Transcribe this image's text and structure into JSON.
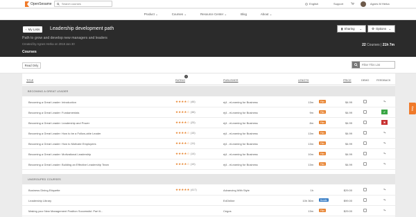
{
  "brand": {
    "name": "OpenSesame"
  },
  "top": {
    "search_placeholder": "Search courses",
    "language": "English",
    "support": "Support",
    "user": "Agnes M Herka"
  },
  "nav": [
    {
      "label": "Product ⌄"
    },
    {
      "label": "Courses ⌄"
    },
    {
      "label": "Resource Center ⌄"
    },
    {
      "label": "Blog"
    },
    {
      "label": "About ⌄"
    }
  ],
  "hero": {
    "back_label": "My Lists",
    "title": "Leadership development path",
    "subtitle": "Path to grow and develop new managers and leaders",
    "created": "Created by Agnes Herka on 2018 Jan 30",
    "sharing": "Sharing",
    "options": "Options",
    "count": "22",
    "count_label": "Courses",
    "duration": "21h 7m",
    "section": "Courses"
  },
  "toolbar": {
    "readonly": "Read Only",
    "filter_placeholder": "Filter This List"
  },
  "columns": {
    "title": "TITLE",
    "rating": "RATING",
    "publisher": "PUBLISHER",
    "length": "LENGTH",
    "price": "PRICE",
    "demo": "DEMO",
    "feedback": "FEEDBACK",
    "help": "?"
  },
  "groups": [
    {
      "label": "BECOMING A GREAT LEADER"
    },
    {
      "label": "UNGROUPED COURSES"
    }
  ],
  "rows": [
    {
      "title": "Becoming a Great Leader: Introduction",
      "stars": "★★★★☆",
      "count": "(46)",
      "publisher": "ej4 - eLearning for Business",
      "length": "13m",
      "tag": "Film",
      "price": "$4.99",
      "feedback": "↷"
    },
    {
      "title": "Becoming a Great Leader: Fundamentals",
      "stars": "★★★★☆",
      "count": "(38)",
      "publisher": "ej4 - eLearning for Business",
      "length": "9m",
      "tag": "Film",
      "price": "$4.99",
      "feedback": "✔"
    },
    {
      "title": "Becoming a Great Leader: Leadership and Power",
      "stars": "★★★★☆",
      "count": "(25)",
      "publisher": "ej4 - eLearning for Business",
      "length": "8m",
      "tag": "Film",
      "price": "$4.99",
      "feedback": "✖"
    },
    {
      "title": "Becoming a Great Leader: How to be a Follow-able Leader",
      "stars": "★★★★☆",
      "count": "(15)",
      "publisher": "ej4 - eLearning for Business",
      "length": "13m",
      "tag": "Film",
      "price": "$4.99",
      "feedback": "↷"
    },
    {
      "title": "Becoming a Great Leader: How to Motivate Employees",
      "stars": "★★★★☆",
      "count": "(11)",
      "publisher": "ej4 - eLearning for Business",
      "length": "13m",
      "tag": "Film",
      "price": "$4.99",
      "feedback": "↷"
    },
    {
      "title": "Becoming a Great Leader: Motivational Leadership",
      "stars": "★★★★☆",
      "count": "(14)",
      "publisher": "ej4 - eLearning for Business",
      "length": "10m",
      "tag": "Film",
      "price": "$4.99",
      "feedback": "↷"
    },
    {
      "title": "Becoming a Great Leader: Building an Effective Leadership Team",
      "stars": "★★★★☆",
      "count": "(19)",
      "publisher": "ej4 - eLearning for Business",
      "length": "13m",
      "tag": "Film",
      "price": "$4.99",
      "feedback": "↷"
    },
    {
      "title": "Business Dining Etiquette",
      "stars": "★★★★★",
      "count": "(417)",
      "publisher": "Advancing With Style",
      "length": "1h",
      "tag": "",
      "price": "$29.00",
      "feedback": "↷"
    },
    {
      "title": "Leadership Library",
      "stars": "",
      "count": "",
      "publisher": "EdOnline",
      "length": "10h 36m",
      "tag": "Bundle",
      "price": "$99.00",
      "feedback": "↷"
    },
    {
      "title": "Making your New Management Position Successful: Part 6...",
      "stars": "",
      "count": "",
      "publisher": "Cegos",
      "length": "13m",
      "tag": "Film",
      "price": "$29.00",
      "feedback": "↷"
    }
  ],
  "side_help": "Help",
  "colors": {
    "accent": "#f07a2a",
    "hero_bg": "#2b2b2b",
    "star": "#e7832d"
  }
}
